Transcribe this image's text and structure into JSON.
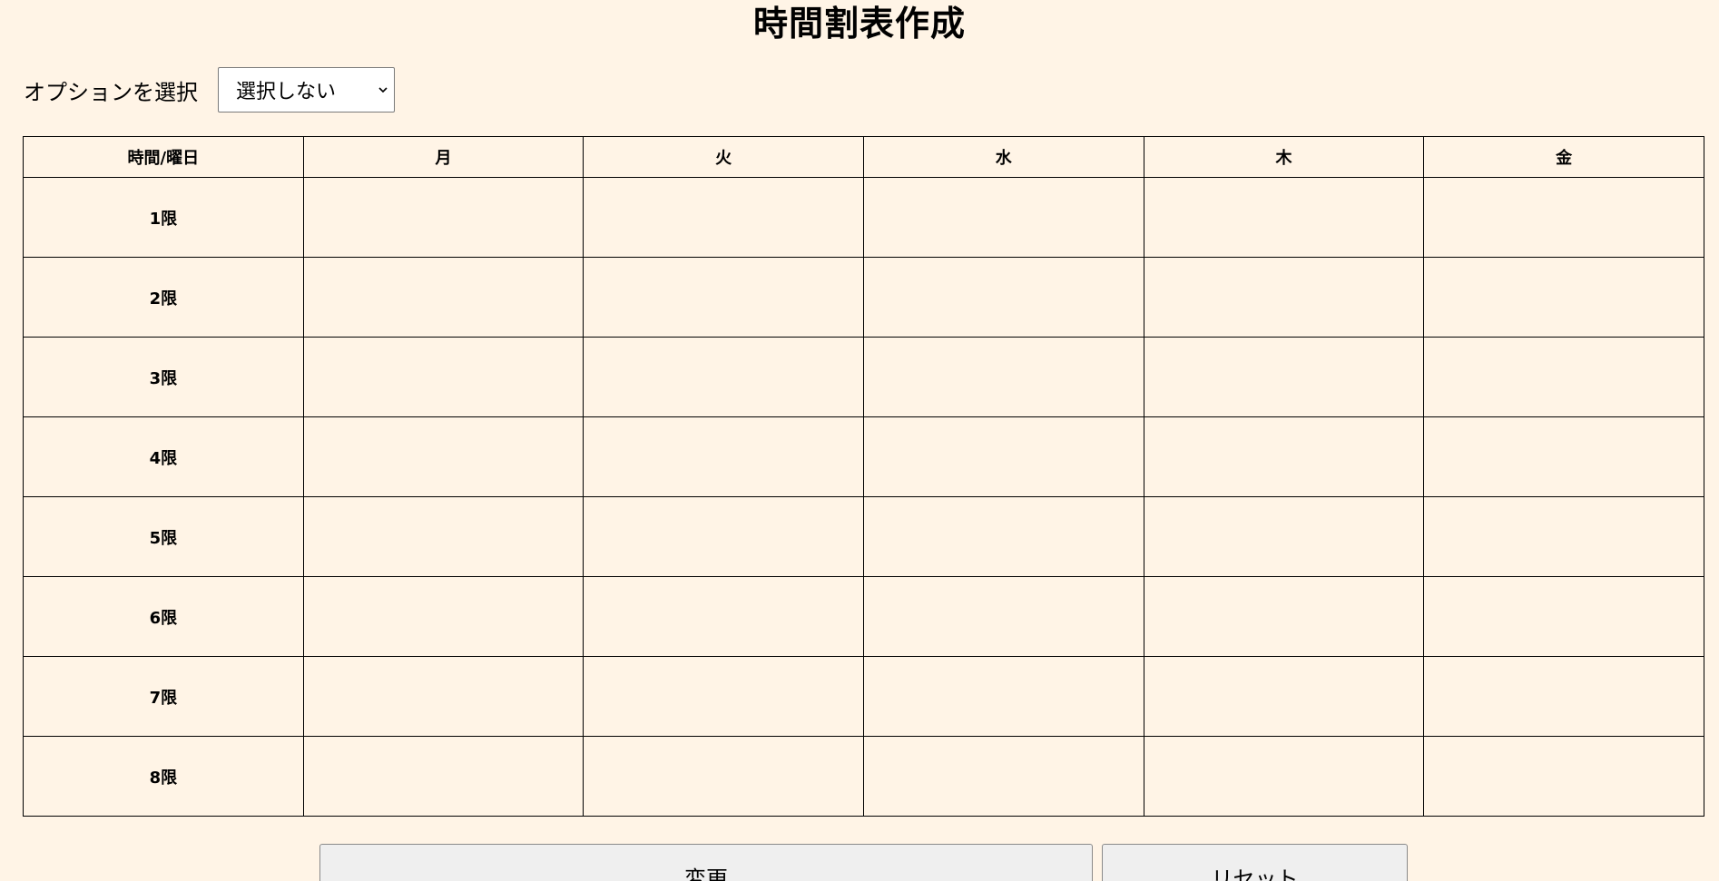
{
  "page": {
    "title": "時間割表作成"
  },
  "options": {
    "label": "オプションを選択",
    "selected": "選択しない"
  },
  "timetable": {
    "corner_header": "時間/曜日",
    "days": [
      "月",
      "火",
      "水",
      "木",
      "金"
    ],
    "periods": [
      "1限",
      "2限",
      "3限",
      "4限",
      "5限",
      "6限",
      "7限",
      "8限"
    ]
  },
  "buttons": {
    "change": "変更",
    "reset": "リセット"
  },
  "colors": {
    "background": "#fff4e6",
    "button_bg": "#efefef",
    "border": "#000000"
  },
  "icons": {
    "select": "chevron-down-icon"
  }
}
